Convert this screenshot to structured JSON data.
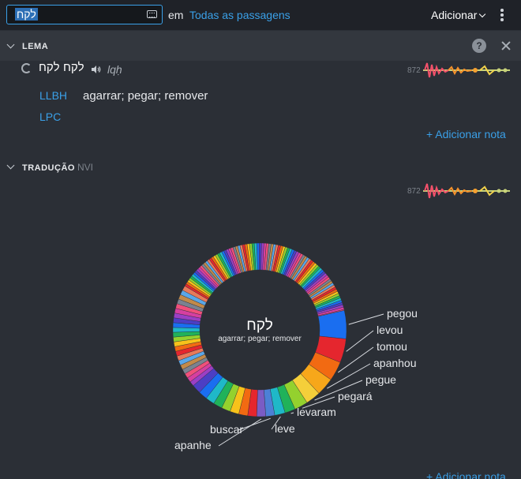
{
  "search": {
    "value": "לקח",
    "scope_prefix": "em",
    "scope_link": "Todas as passagens"
  },
  "toolbar": {
    "add_label": "Adicionar"
  },
  "lema": {
    "header": "LEMA",
    "help_glyph": "?",
    "hebrew": "לקח",
    "hebrew_alt": "לקח",
    "transliteration": "lqḥ",
    "count": "872",
    "lexicons": [
      {
        "abbr": "LLBH",
        "definition": "agarrar; pegar; remover"
      },
      {
        "abbr": "LPC",
        "definition": ""
      }
    ],
    "add_note": "+ Adicionar nota"
  },
  "traducao": {
    "header": "TRADUÇÃO",
    "version": "NVI",
    "count": "872",
    "add_note": "+ Adicionar nota"
  },
  "chart_data": {
    "type": "pie",
    "center_title": "לקח",
    "center_subtitle": "agarrar; pegar; remover",
    "labels": [
      "pegou",
      "levou",
      "tomou",
      "apanhou",
      "pegue",
      "pegará",
      "levaram",
      "leve",
      "buscar",
      "apanhe"
    ],
    "colors": [
      "#1a6ef0",
      "#e5262e",
      "#f26a12",
      "#f7a71a",
      "#f5cf3a",
      "#94d12e",
      "#20b25a",
      "#1fb8c8",
      "#4c80d6",
      "#7a5cc4"
    ]
  }
}
